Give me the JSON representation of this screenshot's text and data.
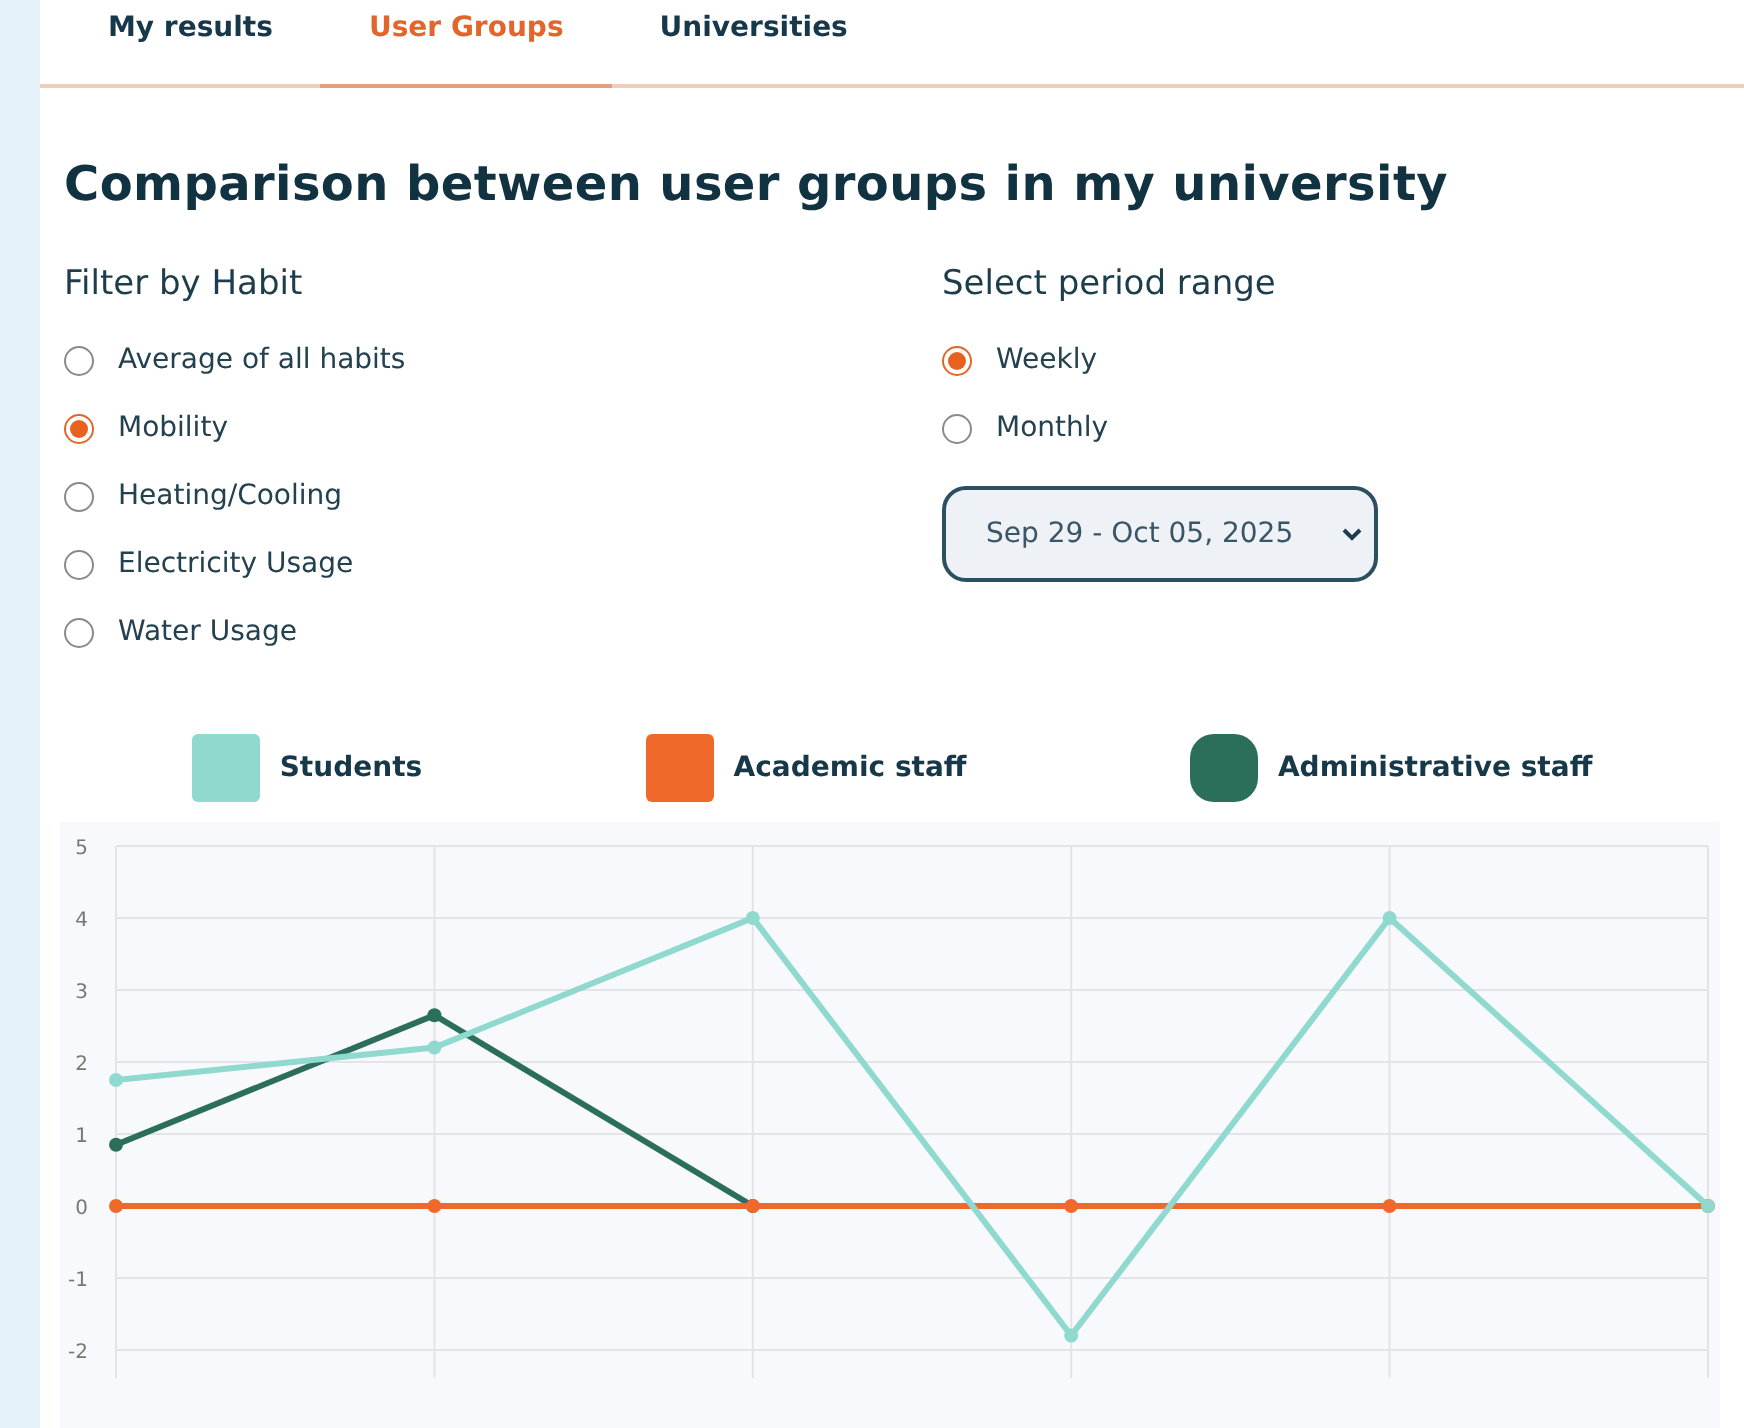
{
  "tabs": [
    {
      "label": "My results",
      "selected": false
    },
    {
      "label": "User Groups",
      "selected": true
    },
    {
      "label": "Universities",
      "selected": false
    }
  ],
  "title": "Comparison between user groups in my university",
  "habit_filter": {
    "heading": "Filter by Habit",
    "options": [
      {
        "label": "Average of all habits",
        "selected": false
      },
      {
        "label": "Mobility",
        "selected": true
      },
      {
        "label": "Heating/Cooling",
        "selected": false
      },
      {
        "label": "Electricity Usage",
        "selected": false
      },
      {
        "label": "Water Usage",
        "selected": false
      }
    ]
  },
  "period": {
    "heading": "Select period range",
    "options": [
      {
        "label": "Weekly",
        "selected": true
      },
      {
        "label": "Monthly",
        "selected": false
      }
    ],
    "range_select": "Sep 29 - Oct 05, 2025"
  },
  "chart": {
    "chart_data": {
      "type": "line",
      "grid": true,
      "ylim": [
        -2.4,
        5
      ],
      "yticks": [
        -2,
        -1,
        0,
        1,
        2,
        3,
        4,
        5
      ],
      "series": [
        {
          "name": "Students",
          "color": "#8fd9cf",
          "marker": "circle",
          "values": [
            1.75,
            2.2,
            4,
            -1.8,
            4,
            0
          ]
        },
        {
          "name": "Academic staff",
          "color": "#ef6a2a",
          "marker": "circle",
          "values": [
            0,
            0,
            0,
            0,
            0,
            0
          ]
        },
        {
          "name": "Administrative staff",
          "color": "#2b6e5c",
          "marker": "circle",
          "values": [
            0.85,
            2.65,
            0,
            null,
            null,
            null
          ]
        }
      ]
    }
  }
}
